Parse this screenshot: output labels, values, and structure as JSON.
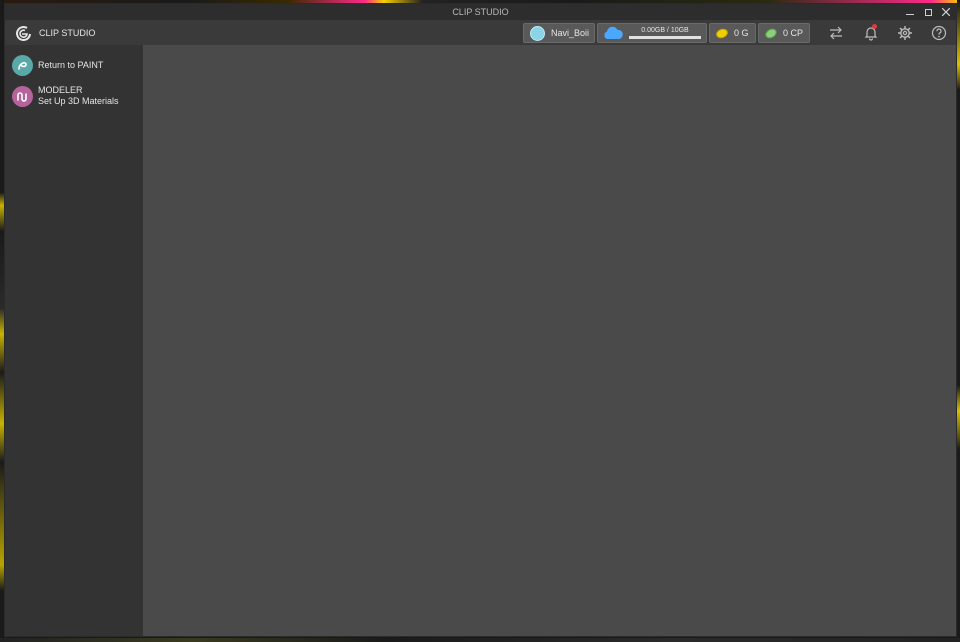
{
  "window": {
    "title": "CLIP STUDIO"
  },
  "header": {
    "brand_label": "CLIP STUDIO",
    "username": "Navi_Boii",
    "storage": {
      "label": "0.00GB / 10GB",
      "used_fraction": 0.0
    },
    "gold_label": "0 G",
    "cp_label": "0 CP",
    "icons": [
      "clip-studio-logo-icon",
      "cloud-icon",
      "gold-coin-icon",
      "cp-coin-icon",
      "sync-icon",
      "bell-icon",
      "gear-icon",
      "help-icon"
    ]
  },
  "sidebar": {
    "items": [
      {
        "label": "Return to PAINT",
        "icon": "paint-pen-icon",
        "icon_color": "#5aa8a8"
      },
      {
        "label": "MODELER",
        "sublabel": "Set Up 3D Materials",
        "icon": "modeler-icon",
        "icon_color": "#b5649b"
      }
    ]
  },
  "colors": {
    "notification_dot": "#e23a3a",
    "cloud": "#4aa8ff"
  }
}
